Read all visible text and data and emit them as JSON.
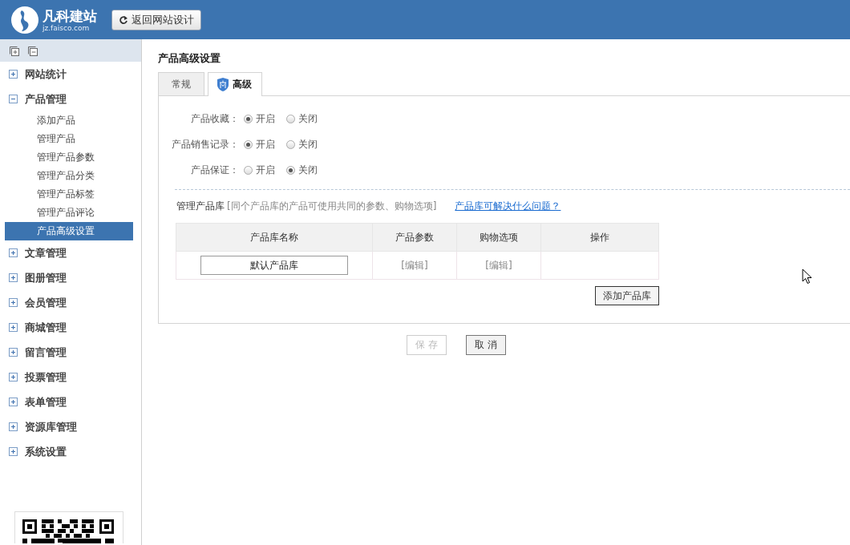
{
  "header": {
    "logo_title": "凡科建站",
    "logo_url": "jz.faisco.com",
    "back_button": "返回网站设计"
  },
  "sidebar": {
    "items": [
      {
        "label": "网站统计",
        "expanded": false
      },
      {
        "label": "产品管理",
        "expanded": true,
        "children": [
          {
            "label": "添加产品",
            "selected": false
          },
          {
            "label": "管理产品",
            "selected": false
          },
          {
            "label": "管理产品参数",
            "selected": false
          },
          {
            "label": "管理产品分类",
            "selected": false
          },
          {
            "label": "管理产品标签",
            "selected": false
          },
          {
            "label": "管理产品评论",
            "selected": false
          },
          {
            "label": "产品高级设置",
            "selected": true
          }
        ]
      },
      {
        "label": "文章管理",
        "expanded": false
      },
      {
        "label": "图册管理",
        "expanded": false
      },
      {
        "label": "会员管理",
        "expanded": false
      },
      {
        "label": "商城管理",
        "expanded": false
      },
      {
        "label": "留言管理",
        "expanded": false
      },
      {
        "label": "投票管理",
        "expanded": false
      },
      {
        "label": "表单管理",
        "expanded": false
      },
      {
        "label": "资源库管理",
        "expanded": false
      },
      {
        "label": "系统设置",
        "expanded": false
      }
    ]
  },
  "page_title": "产品高级设置",
  "tabs": [
    {
      "label": "常规",
      "selected": false
    },
    {
      "label": "高级",
      "selected": true
    }
  ],
  "settings": [
    {
      "label": "产品收藏：",
      "options": [
        {
          "label": "开启",
          "selected": true
        },
        {
          "label": "关闭",
          "selected": false
        }
      ]
    },
    {
      "label": "产品销售记录：",
      "options": [
        {
          "label": "开启",
          "selected": true
        },
        {
          "label": "关闭",
          "selected": false
        }
      ]
    },
    {
      "label": "产品保证：",
      "options": [
        {
          "label": "开启",
          "selected": false
        },
        {
          "label": "关闭",
          "selected": true
        }
      ]
    }
  ],
  "library": {
    "title": "管理产品库",
    "hint": "[同个产品库的产品可使用共同的参数、购物选项]",
    "help_link": "产品库可解决什么问题？",
    "columns": [
      "产品库名称",
      "产品参数",
      "购物选项",
      "操作"
    ],
    "rows": [
      {
        "name": "默认产品库",
        "params": "[编辑]",
        "options": "[编辑]"
      }
    ],
    "add_button": "添加产品库"
  },
  "buttons": [
    {
      "label": "保 存",
      "disabled": true
    },
    {
      "label": "取 消",
      "disabled": false
    }
  ]
}
